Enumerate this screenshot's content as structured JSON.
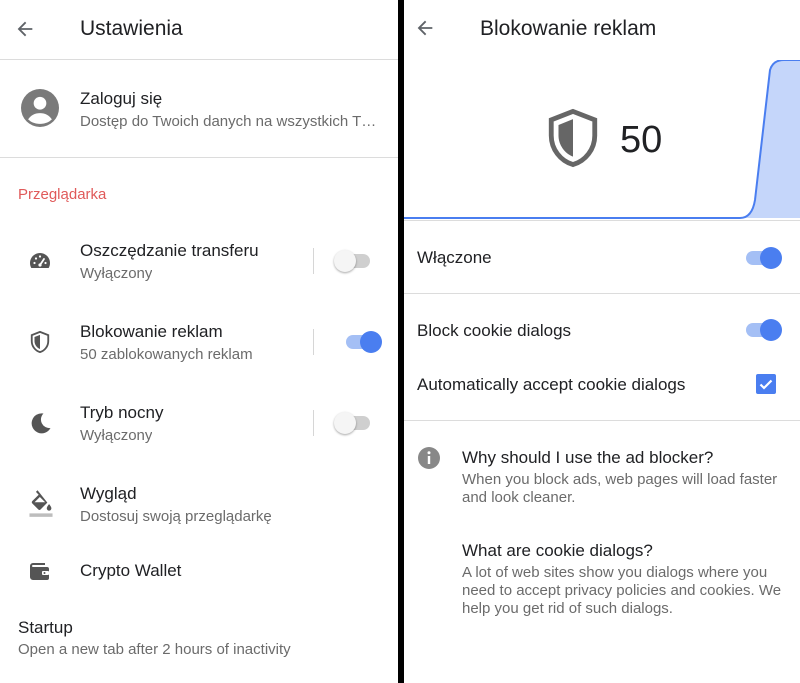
{
  "left": {
    "title": "Ustawienia",
    "account": {
      "title": "Zaloguj się",
      "subtitle": "Dostęp do Twoich danych na wszystkich T…",
      "icon": "account-circle-icon"
    },
    "section_label": "Przeglądarka",
    "items": [
      {
        "title": "Oszczędzanie transferu",
        "subtitle": "Wyłączony",
        "icon": "speedometer-icon",
        "toggle": false
      },
      {
        "title": "Blokowanie reklam",
        "subtitle": "50 zablokowanych reklam",
        "icon": "shield-icon",
        "toggle": true
      },
      {
        "title": "Tryb nocny",
        "subtitle": "Wyłączony",
        "icon": "moon-icon",
        "toggle": false
      },
      {
        "title": "Wygląd",
        "subtitle": "Dostosuj swoją przeglądarkę",
        "icon": "paint-bucket-icon"
      },
      {
        "title": "Crypto Wallet",
        "icon": "wallet-icon"
      }
    ],
    "startup": {
      "title": "Startup",
      "subtitle": "Open a new tab after 2 hours of inactivity"
    }
  },
  "right": {
    "title": "Blokowanie reklam",
    "blocked_count": "50",
    "colors": {
      "accent": "#4a7ef0",
      "chart_fill": "#c5d6fa",
      "chart_line": "#4a7ef0"
    },
    "settings": [
      {
        "label": "Włączone",
        "type": "toggle",
        "value": true
      },
      {
        "label": "Block cookie dialogs",
        "type": "toggle",
        "value": true
      },
      {
        "label": "Automatically accept cookie dialogs",
        "type": "checkbox",
        "value": true
      }
    ],
    "info": [
      {
        "title": "Why should I use the ad blocker?",
        "text": "When you block ads, web pages will load faster and look cleaner."
      },
      {
        "title": "What are cookie dialogs?",
        "text": "A lot of web sites show you dialogs where you need to accept privacy policies and cookies. We help you get rid of such dialogs."
      }
    ]
  }
}
